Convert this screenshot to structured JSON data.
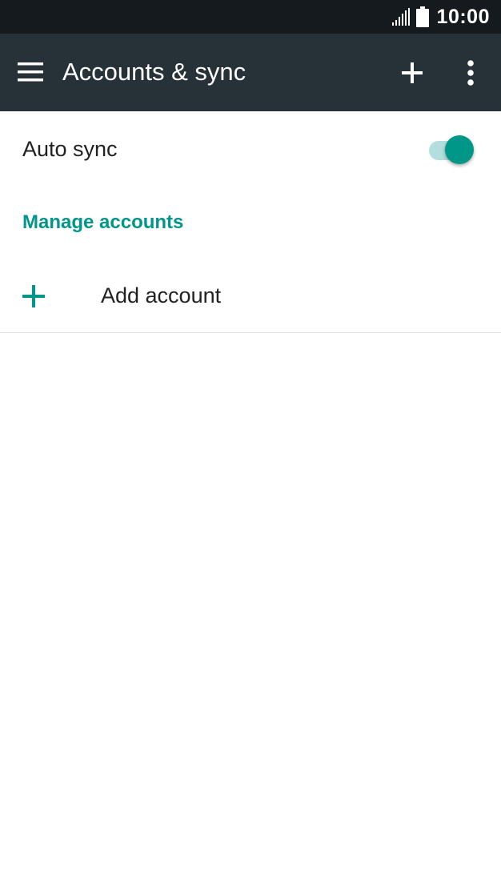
{
  "status_bar": {
    "time": "10:00",
    "signal_icon": "signal-icon",
    "battery_icon": "battery-icon"
  },
  "app_bar": {
    "title": "Accounts & sync",
    "menu_icon": "menu-icon",
    "add_icon": "plus-icon",
    "overflow_icon": "more-vert-icon",
    "background": "#263238"
  },
  "settings": {
    "auto_sync": {
      "label": "Auto sync",
      "enabled": true
    },
    "section_header": "Manage accounts",
    "add_account": {
      "label": "Add account",
      "icon": "plus-icon"
    }
  },
  "colors": {
    "accent": "#009688",
    "accent_light": "#b2dfdb",
    "status_bar": "#141a1e",
    "text_primary": "#212121"
  }
}
